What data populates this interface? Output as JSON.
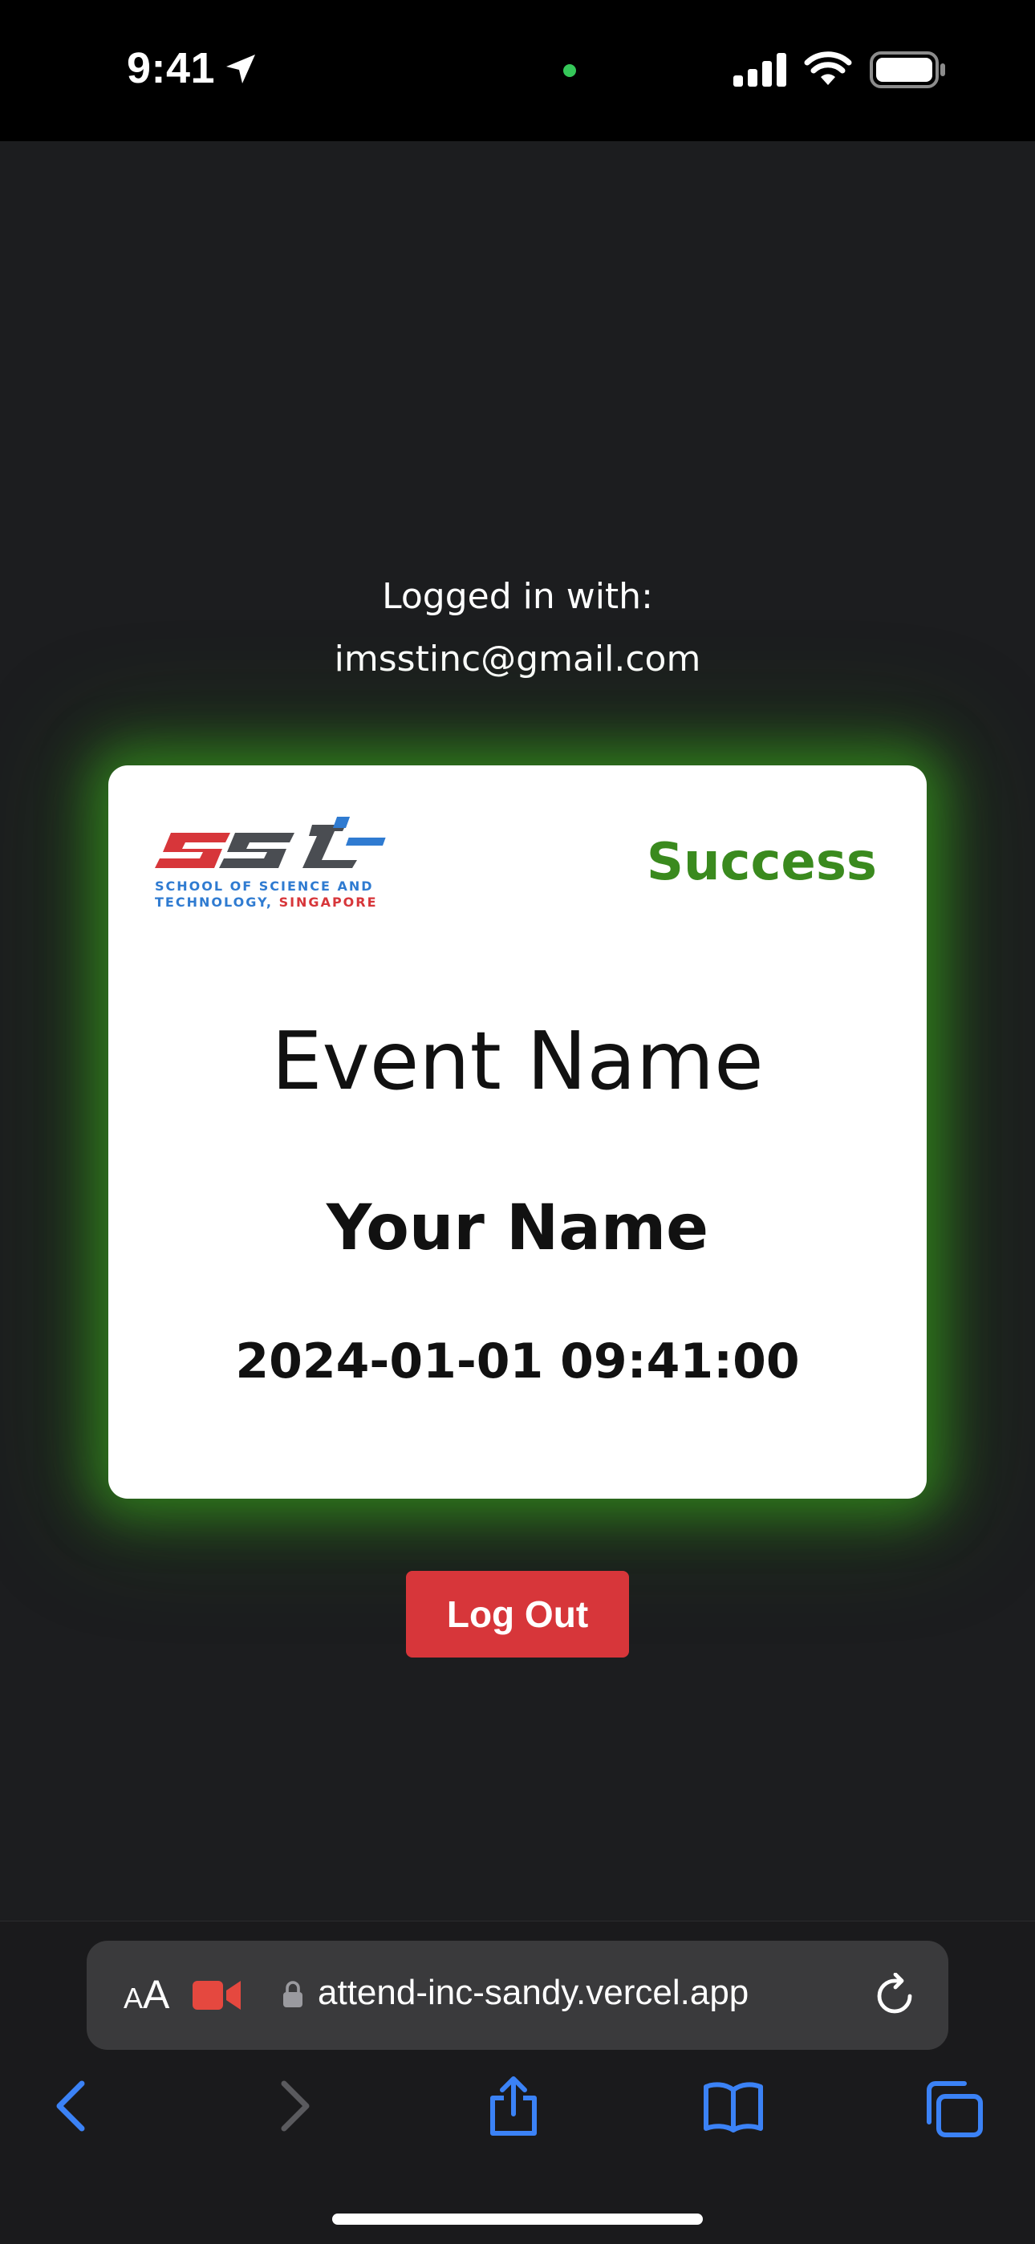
{
  "status_bar": {
    "time": "9:41",
    "icons": [
      "location-arrow-icon",
      "camera-indicator-icon",
      "cellular-signal-icon",
      "wifi-icon",
      "battery-icon"
    ]
  },
  "login": {
    "label": "Logged in with:",
    "email": "imsstinc@gmail.com"
  },
  "card": {
    "logo_text": "SST",
    "logo_subtitle_line1": "SCHOOL OF SCIENCE AND",
    "logo_subtitle_line2_a": "TECHNOLOGY, ",
    "logo_subtitle_line2_b": "SINGAPORE",
    "status": "Success",
    "event_name": "Event Name",
    "user_name": "Your Name",
    "timestamp": "2024-01-01 09:41:00"
  },
  "actions": {
    "logout_label": "Log Out"
  },
  "browser": {
    "text_size_small": "A",
    "text_size_large": "A",
    "url": "attend-inc-sandy.vercel.app",
    "icons": [
      "text-size-icon",
      "video-icon",
      "lock-icon",
      "reload-icon",
      "back-icon",
      "forward-icon",
      "share-icon",
      "bookmarks-icon",
      "tabs-icon"
    ]
  },
  "colors": {
    "background": "#1c1d1f",
    "success": "#3a8a1e",
    "glow": "#3caf1e",
    "logout": "#d7363a",
    "safari_accent": "#3b82f6"
  }
}
